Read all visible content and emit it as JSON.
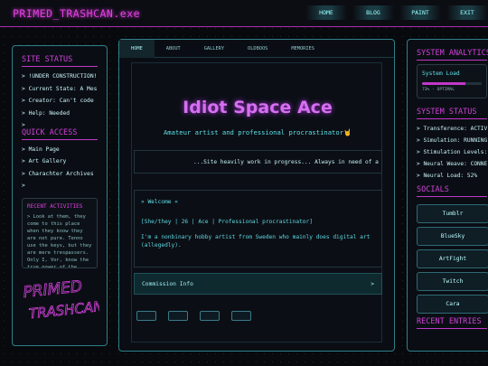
{
  "header": {
    "logo": "PRIMED_TRASHCAN.exe",
    "nav": [
      "HOME",
      "BLOG",
      "PAINT",
      "EXIT"
    ]
  },
  "left": {
    "status_title": "SITE STATUS",
    "status_items": [
      "> !UNDER CONSTRUCTION!",
      "> Current State: A Mess",
      "> Creator: Can't code",
      "> Help: Needed",
      ">"
    ],
    "quick_title": "QUICK ACCESS",
    "quick_items": [
      "> Main Page",
      "> Art Gallery",
      "> Charachter Archives",
      ">"
    ],
    "recent_title": "RECENT ACTIVITIES",
    "recent_text": "> Look at them, they come to this place when they know they are not pure. Tenno use the keys, but they are mere trespassers. Only I, Vor, know the true power of the Void. I was cut",
    "brand_lines": [
      "PRIMED",
      "TRASHCAN"
    ]
  },
  "main": {
    "tabs": [
      "HOME",
      "ABOUT",
      "GALLERY",
      "OLDBOOS",
      "MEMORIES"
    ],
    "title": "Idiot Space Ace",
    "subtitle": "Amateur artist and professional procrastinator🤘",
    "notice": "...Site heavily work in progress... Always in need of a na",
    "welcome_title": "» Welcome «",
    "welcome_line1": "[She/they | 26 | Ace | Professional procrastinator]",
    "welcome_line2": "I'm a nonbinary hobby artist from Sweden who mainly does digital art (allegedly).",
    "commission_label": "Commission Info",
    "commission_arrow": ">"
  },
  "right": {
    "analytics_title": "SYSTEM ANALYTICS",
    "load_label": "System Load",
    "load_percent": 73,
    "load_text": "73% - OPTIMAL",
    "status_title": "SYSTEM STATUS",
    "status_items": [
      "> Transference: ACTIVE",
      "> Simulation: RUNNING",
      "> Stimulation Levels: ...",
      "> Neural Weave: CONNECTED",
      "> Neural Load: 52%"
    ],
    "socials_title": "SOCIALS",
    "socials": [
      "Tumblr",
      "BlueSky",
      "ArtFight",
      "Twitch",
      "Cara"
    ],
    "entries_title": "RECENT ENTRIES"
  },
  "colors": {
    "accent": "#d040d8",
    "cyan": "#5fe0e8",
    "background": "#07090d"
  }
}
